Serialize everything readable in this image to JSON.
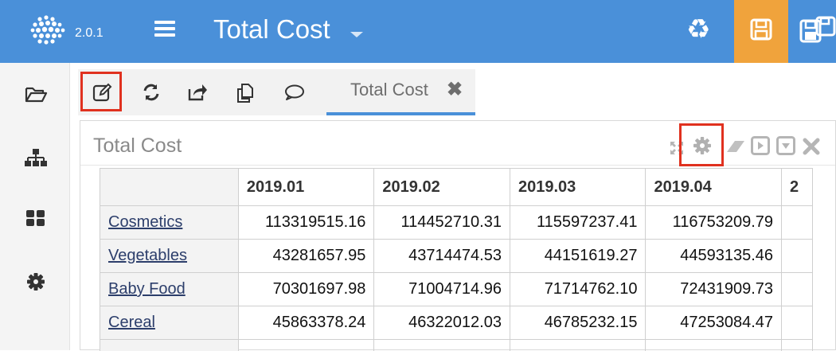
{
  "app": {
    "version": "2.0.1",
    "title": "Total Cost",
    "accent_color": "#4a90d9",
    "save_color": "#f0a33c",
    "highlight_color": "#e0311f"
  },
  "header": {
    "icons": [
      "logo-icon",
      "hamburger-menu-icon",
      "title-dropdown-caret-icon",
      "recycle-icon",
      "save-icon",
      "save-as-icon"
    ]
  },
  "sidebar": {
    "items": [
      {
        "name": "open-folder",
        "icon": "folder-open-icon"
      },
      {
        "name": "hierarchy",
        "icon": "sitemap-icon"
      },
      {
        "name": "dashboard",
        "icon": "grid-icon"
      },
      {
        "name": "settings",
        "icon": "gear-icon"
      }
    ]
  },
  "toolbar": {
    "icons": [
      "edit-icon",
      "refresh-icon",
      "share-icon",
      "copy-icon",
      "comment-icon"
    ]
  },
  "tab": {
    "label": "Total Cost",
    "close_symbol": "✖"
  },
  "panel": {
    "title": "Total Cost",
    "tool_icons": [
      "expand-icon",
      "gear-icon",
      "eraser-icon",
      "play-icon",
      "dropdown-icon",
      "close-icon"
    ]
  },
  "table": {
    "columns": [
      "2019.01",
      "2019.02",
      "2019.03",
      "2019.04",
      "2"
    ],
    "rows": [
      {
        "label": "Cosmetics",
        "values": [
          "113319515.16",
          "114452710.31",
          "115597237.41",
          "116753209.79"
        ]
      },
      {
        "label": "Vegetables",
        "values": [
          "43281657.95",
          "43714474.53",
          "44151619.27",
          "44593135.46"
        ]
      },
      {
        "label": "Baby Food",
        "values": [
          "70301697.98",
          "71004714.96",
          "71714762.10",
          "72431909.73"
        ]
      },
      {
        "label": "Cereal",
        "values": [
          "45863378.24",
          "46322012.03",
          "46785232.15",
          "47253084.47"
        ]
      }
    ]
  }
}
